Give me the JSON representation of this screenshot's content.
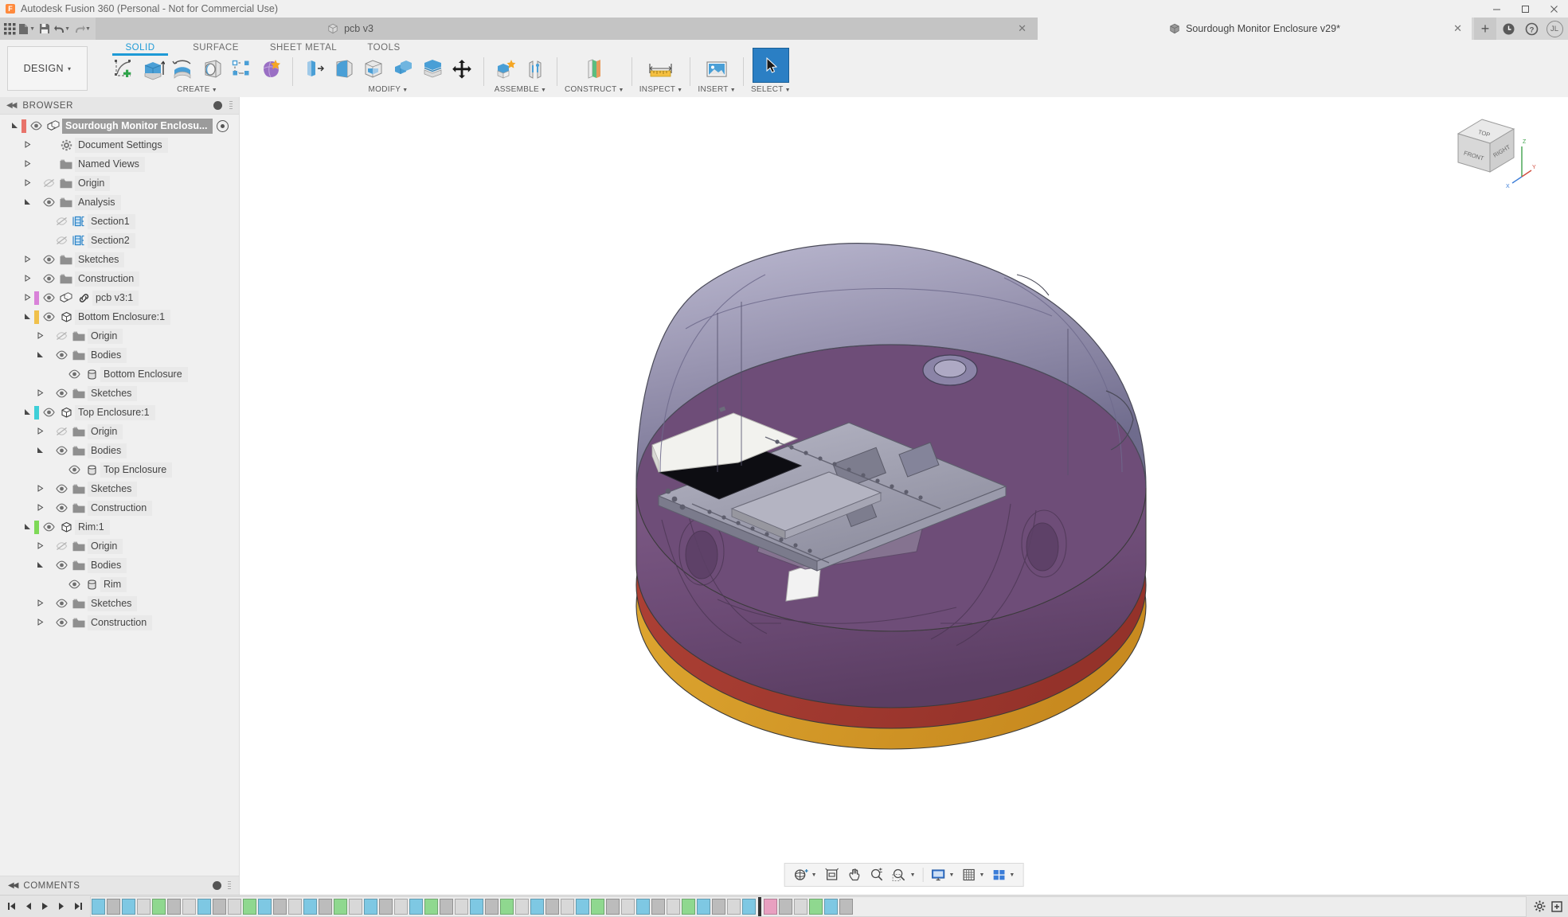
{
  "app": {
    "title": "Autodesk Fusion 360 (Personal - Not for Commercial Use)",
    "logo_text": "F",
    "window_controls": {
      "minimize": "–",
      "maximize": "☐",
      "close": "✕"
    }
  },
  "quick_access": {
    "grid_icon": "app-grid-icon",
    "new_icon": "new-document-icon",
    "save_icon": "save-icon",
    "undo_icon": "undo-icon",
    "redo_icon": "redo-icon",
    "add_tab_label": "+",
    "recent_icon": "recent-icon",
    "help_icon": "help-icon",
    "avatar_initials": "JL"
  },
  "tabs": [
    {
      "label": "pcb v3",
      "active": false,
      "close": "✕"
    },
    {
      "label": "Sourdough Monitor Enclosure v29*",
      "active": true,
      "close": "✕"
    }
  ],
  "ribbon": {
    "workspace": "DESIGN",
    "workspace_caret": "▾",
    "tabs": [
      {
        "label": "SOLID",
        "active": true
      },
      {
        "label": "SURFACE",
        "active": false
      },
      {
        "label": "SHEET METAL",
        "active": false
      },
      {
        "label": "TOOLS",
        "active": false
      }
    ],
    "groups": [
      {
        "label": "CREATE",
        "has_caret": true,
        "icons": [
          "create-sketch-icon",
          "extrude-icon",
          "revolve-icon",
          "sweep-icon",
          "rib-icon",
          "form-icon"
        ]
      },
      {
        "label": "MODIFY",
        "has_caret": true,
        "icons": [
          "press-pull-icon",
          "fillet-icon",
          "shell-icon",
          "combine-icon",
          "split-face-icon",
          "move-copy-icon"
        ]
      },
      {
        "label": "ASSEMBLE",
        "has_caret": true,
        "icons": [
          "new-component-icon",
          "joint-icon"
        ]
      },
      {
        "label": "CONSTRUCT",
        "has_caret": true,
        "icons": [
          "offset-plane-icon"
        ]
      },
      {
        "label": "INSPECT",
        "has_caret": true,
        "icons": [
          "measure-icon"
        ]
      },
      {
        "label": "INSERT",
        "has_caret": true,
        "icons": [
          "insert-image-icon"
        ]
      },
      {
        "label": "SELECT",
        "has_caret": true,
        "icons": [
          "select-cursor-icon"
        ],
        "selected": true
      }
    ]
  },
  "browser": {
    "header": "BROWSER",
    "collapse_icon": "collapse-left-icon",
    "nodes": [
      {
        "label": "Sourdough Monitor Enclosu...",
        "depth": 0,
        "arrow": "open",
        "eye": "visible",
        "icon": "component-icon",
        "strip": "#e8736a",
        "root": true
      },
      {
        "label": "Document Settings",
        "depth": 1,
        "arrow": "closed",
        "eye": "none",
        "icon": "gear-icon",
        "strip": "none"
      },
      {
        "label": "Named Views",
        "depth": 1,
        "arrow": "closed",
        "eye": "none",
        "icon": "folder-icon",
        "strip": "none"
      },
      {
        "label": "Origin",
        "depth": 1,
        "arrow": "closed",
        "eye": "hidden",
        "icon": "folder-icon",
        "strip": "none"
      },
      {
        "label": "Analysis",
        "depth": 1,
        "arrow": "open",
        "eye": "visible",
        "icon": "folder-icon",
        "strip": "none"
      },
      {
        "label": "Section1",
        "depth": 2,
        "arrow": "none",
        "eye": "hidden",
        "icon": "section-analysis-icon",
        "strip": "none"
      },
      {
        "label": "Section2",
        "depth": 2,
        "arrow": "none",
        "eye": "hidden",
        "icon": "section-analysis-icon",
        "strip": "none"
      },
      {
        "label": "Sketches",
        "depth": 1,
        "arrow": "closed",
        "eye": "visible",
        "icon": "folder-icon",
        "strip": "none"
      },
      {
        "label": "Construction",
        "depth": 1,
        "arrow": "closed",
        "eye": "visible",
        "icon": "folder-icon",
        "strip": "none"
      },
      {
        "label": "pcb v3:1",
        "depth": 1,
        "arrow": "closed",
        "eye": "visible",
        "icon": "component-icon",
        "strip": "#d982d9",
        "link": true
      },
      {
        "label": "Bottom Enclosure:1",
        "depth": 1,
        "arrow": "open",
        "eye": "visible",
        "icon": "body-cube-icon",
        "strip": "#f0c04a"
      },
      {
        "label": "Origin",
        "depth": 2,
        "arrow": "closed",
        "eye": "hidden",
        "icon": "folder-icon",
        "strip": "none"
      },
      {
        "label": "Bodies",
        "depth": 2,
        "arrow": "open",
        "eye": "visible",
        "icon": "folder-icon",
        "strip": "none"
      },
      {
        "label": "Bottom Enclosure",
        "depth": 3,
        "arrow": "none",
        "eye": "visible",
        "icon": "body-icon",
        "strip": "none"
      },
      {
        "label": "Sketches",
        "depth": 2,
        "arrow": "closed",
        "eye": "visible",
        "icon": "folder-icon",
        "strip": "none"
      },
      {
        "label": "Top Enclosure:1",
        "depth": 1,
        "arrow": "open",
        "eye": "visible",
        "icon": "body-cube-icon",
        "strip": "#3ecfd8"
      },
      {
        "label": "Origin",
        "depth": 2,
        "arrow": "closed",
        "eye": "hidden",
        "icon": "folder-icon",
        "strip": "none"
      },
      {
        "label": "Bodies",
        "depth": 2,
        "arrow": "open",
        "eye": "visible",
        "icon": "folder-icon",
        "strip": "none"
      },
      {
        "label": "Top Enclosure",
        "depth": 3,
        "arrow": "none",
        "eye": "visible",
        "icon": "body-icon",
        "strip": "none"
      },
      {
        "label": "Sketches",
        "depth": 2,
        "arrow": "closed",
        "eye": "visible",
        "icon": "folder-icon",
        "strip": "none"
      },
      {
        "label": "Construction",
        "depth": 2,
        "arrow": "closed",
        "eye": "visible",
        "icon": "folder-icon",
        "strip": "none"
      },
      {
        "label": "Rim:1",
        "depth": 1,
        "arrow": "open",
        "eye": "visible",
        "icon": "body-cube-icon",
        "strip": "#7ed957"
      },
      {
        "label": "Origin",
        "depth": 2,
        "arrow": "closed",
        "eye": "hidden",
        "icon": "folder-icon",
        "strip": "none"
      },
      {
        "label": "Bodies",
        "depth": 2,
        "arrow": "open",
        "eye": "visible",
        "icon": "folder-icon",
        "strip": "none"
      },
      {
        "label": "Rim",
        "depth": 3,
        "arrow": "none",
        "eye": "visible",
        "icon": "body-icon",
        "strip": "none"
      },
      {
        "label": "Sketches",
        "depth": 2,
        "arrow": "closed",
        "eye": "visible",
        "icon": "folder-icon",
        "strip": "none"
      },
      {
        "label": "Construction",
        "depth": 2,
        "arrow": "closed",
        "eye": "visible",
        "icon": "folder-icon",
        "strip": "none"
      }
    ]
  },
  "comments": {
    "label": "COMMENTS",
    "collapse_icon": "collapse-left-icon"
  },
  "viewcube": {
    "front_label": "FRONT",
    "right_label": "RIGHT",
    "top_label": "TOP",
    "axis_z": "Z",
    "axis_y": "Y",
    "axis_x": "X"
  },
  "navbar": {
    "items": [
      {
        "name": "orbit-icon",
        "caret": true
      },
      {
        "name": "look-at-icon",
        "caret": false
      },
      {
        "name": "pan-hand-icon",
        "caret": false
      },
      {
        "name": "zoom-icon",
        "caret": false
      },
      {
        "name": "fit-zoom-window-icon",
        "caret": true
      },
      {
        "name": "display-settings-icon",
        "caret": true
      },
      {
        "name": "grid-snaps-icon",
        "caret": true
      },
      {
        "name": "viewports-icon",
        "caret": true
      }
    ]
  },
  "timeline": {
    "nav_buttons": [
      "go-to-beginning-icon",
      "step-back-icon",
      "play-icon",
      "step-forward-icon",
      "go-to-end-icon"
    ],
    "settings_icon": "timeline-settings-icon",
    "expand_icon": "timeline-expand-icon",
    "features": [
      "#7ec8e3",
      "#bcbcbc",
      "#7ec8e3",
      "#d8d8d8",
      "#8fd88f",
      "#bcbcbc",
      "#d8d8d8",
      "#7ec8e3",
      "#bcbcbc",
      "#d8d8d8",
      "#8fd88f",
      "#7ec8e3",
      "#bcbcbc",
      "#d8d8d8",
      "#7ec8e3",
      "#bcbcbc",
      "#8fd88f",
      "#d8d8d8",
      "#7ec8e3",
      "#bcbcbc",
      "#d8d8d8",
      "#7ec8e3",
      "#8fd88f",
      "#bcbcbc",
      "#d8d8d8",
      "#7ec8e3",
      "#bcbcbc",
      "#8fd88f",
      "#d8d8d8",
      "#7ec8e3",
      "#bcbcbc",
      "#d8d8d8",
      "#7ec8e3",
      "#8fd88f",
      "#bcbcbc",
      "#d8d8d8",
      "#7ec8e3",
      "#bcbcbc",
      "#d8d8d8",
      "#8fd88f",
      "#7ec8e3",
      "#bcbcbc",
      "#d8d8d8",
      "#7ec8e3",
      "#e8a0c0",
      "#bcbcbc",
      "#d8d8d8",
      "#8fd88f",
      "#7ec8e3",
      "#bcbcbc"
    ]
  },
  "model": {
    "description": "Sourdough monitor enclosure assembly — transparent purple dome over a PCB with black OLED display, yellow/orange base rim",
    "colors": {
      "dome_purple": "#6f6a92",
      "body_purple": "#6e4d78",
      "rim_orange": "#d79a2b",
      "rim_red": "#a5382f",
      "pcb_gray": "#9a9aa8",
      "display_black": "#0d0d12"
    }
  }
}
